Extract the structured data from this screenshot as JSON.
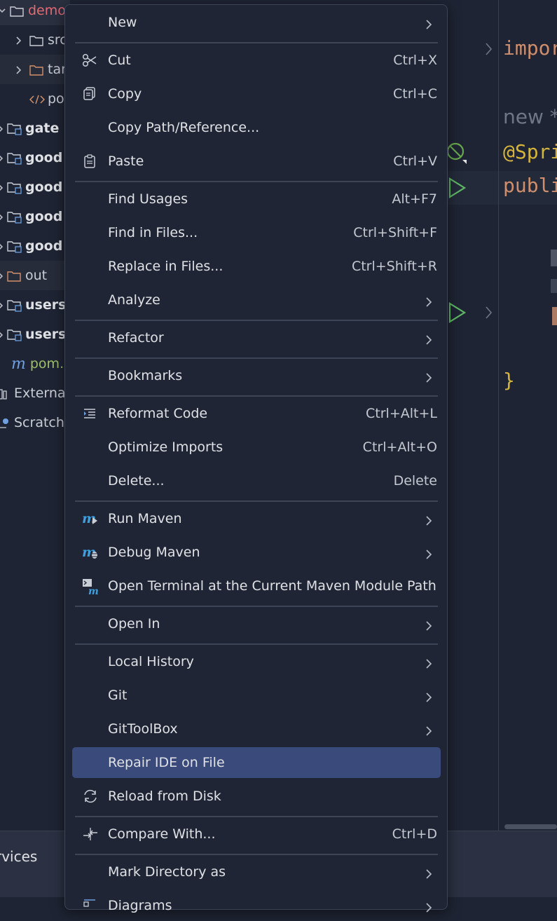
{
  "tree": {
    "items": [
      {
        "label": "demo",
        "kind": "folder",
        "color": "#e06c75"
      },
      {
        "label": "src",
        "kind": "folder",
        "color": "#c9cdd6"
      },
      {
        "label": "tar",
        "kind": "folder",
        "color": "#d0906a"
      },
      {
        "label": "po",
        "kind": "xml",
        "color": "#c9cdd6"
      },
      {
        "label": "gate",
        "kind": "module",
        "color": "#dfe1e5"
      },
      {
        "label": "good",
        "kind": "module",
        "color": "#dfe1e5"
      },
      {
        "label": "good",
        "kind": "module",
        "color": "#dfe1e5"
      },
      {
        "label": "good",
        "kind": "module",
        "color": "#dfe1e5"
      },
      {
        "label": "good",
        "kind": "module",
        "color": "#dfe1e5"
      },
      {
        "label": "out",
        "kind": "folder",
        "color": "#d0906a"
      },
      {
        "label": "users",
        "kind": "module",
        "color": "#dfe1e5"
      },
      {
        "label": "users",
        "kind": "module",
        "color": "#dfe1e5"
      },
      {
        "label": "pom.",
        "kind": "maven",
        "color": "#9fbf6a"
      },
      {
        "label": "External",
        "kind": "library",
        "color": "#c9cdd6"
      },
      {
        "label": "Scratch",
        "kind": "scratch",
        "color": "#c9cdd6"
      }
    ]
  },
  "editor": {
    "line1": "impor",
    "line2": "new *",
    "line3": "@Spri",
    "line4": "publi",
    "line5": "}"
  },
  "bottom": {
    "label": "rvices"
  },
  "menu": {
    "items": [
      {
        "label": "New",
        "shortcut": "",
        "submenu": true,
        "icon": ""
      },
      {
        "sep": true
      },
      {
        "label": "Cut",
        "shortcut": "Ctrl+X",
        "submenu": false,
        "icon": "scissors-icon"
      },
      {
        "label": "Copy",
        "shortcut": "Ctrl+C",
        "submenu": false,
        "icon": "copy-icon"
      },
      {
        "label": "Copy Path/Reference...",
        "shortcut": "",
        "submenu": false,
        "icon": ""
      },
      {
        "label": "Paste",
        "shortcut": "Ctrl+V",
        "submenu": false,
        "icon": "paste-icon"
      },
      {
        "sep": true
      },
      {
        "label": "Find Usages",
        "shortcut": "Alt+F7",
        "submenu": false,
        "icon": ""
      },
      {
        "label": "Find in Files...",
        "shortcut": "Ctrl+Shift+F",
        "submenu": false,
        "icon": ""
      },
      {
        "label": "Replace in Files...",
        "shortcut": "Ctrl+Shift+R",
        "submenu": false,
        "icon": ""
      },
      {
        "label": "Analyze",
        "shortcut": "",
        "submenu": true,
        "icon": ""
      },
      {
        "sep": true
      },
      {
        "label": "Refactor",
        "shortcut": "",
        "submenu": true,
        "icon": ""
      },
      {
        "sep": true
      },
      {
        "label": "Bookmarks",
        "shortcut": "",
        "submenu": true,
        "icon": ""
      },
      {
        "sep": true
      },
      {
        "label": "Reformat Code",
        "shortcut": "Ctrl+Alt+L",
        "submenu": false,
        "icon": "reformat-icon"
      },
      {
        "label": "Optimize Imports",
        "shortcut": "Ctrl+Alt+O",
        "submenu": false,
        "icon": ""
      },
      {
        "label": "Delete...",
        "shortcut": "Delete",
        "submenu": false,
        "icon": ""
      },
      {
        "sep": true
      },
      {
        "label": "Run Maven",
        "shortcut": "",
        "submenu": true,
        "icon": "run-maven-icon"
      },
      {
        "label": "Debug Maven",
        "shortcut": "",
        "submenu": true,
        "icon": "debug-maven-icon"
      },
      {
        "label": "Open Terminal at the Current Maven Module Path",
        "shortcut": "",
        "submenu": false,
        "icon": "maven-terminal-icon"
      },
      {
        "sep": true
      },
      {
        "label": "Open In",
        "shortcut": "",
        "submenu": true,
        "icon": ""
      },
      {
        "sep": true
      },
      {
        "label": "Local History",
        "shortcut": "",
        "submenu": true,
        "icon": ""
      },
      {
        "label": "Git",
        "shortcut": "",
        "submenu": true,
        "icon": ""
      },
      {
        "label": "GitToolBox",
        "shortcut": "",
        "submenu": true,
        "icon": ""
      },
      {
        "label": "Repair IDE on File",
        "shortcut": "",
        "submenu": false,
        "icon": "",
        "active": true
      },
      {
        "label": "Reload from Disk",
        "shortcut": "",
        "submenu": false,
        "icon": "reload-icon"
      },
      {
        "sep": true
      },
      {
        "label": "Compare With...",
        "shortcut": "Ctrl+D",
        "submenu": false,
        "icon": "compare-icon"
      },
      {
        "sep": true
      },
      {
        "label": "Mark Directory as",
        "shortcut": "",
        "submenu": true,
        "icon": ""
      },
      {
        "label": "Diagrams",
        "shortcut": "",
        "submenu": true,
        "icon": "diagrams-icon"
      }
    ]
  }
}
